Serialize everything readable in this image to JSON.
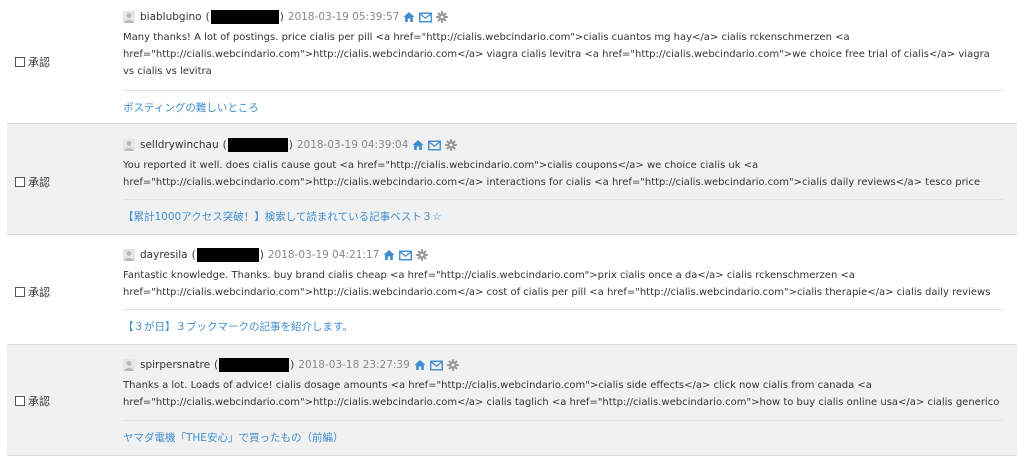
{
  "colors": {
    "link": "#3f8dd0",
    "icon_gray": "#999999",
    "row_alt_bg": "#f1f1f1"
  },
  "comments": [
    {
      "approve_label": "承認",
      "author": "biablubgino",
      "paren_open": "(",
      "paren_close": ")",
      "date": "2018-03-19 05:39:57",
      "body": "Many thanks! A lot of postings. price cialis per pill <a href=\"http://cialis.webcindario.com\">cialis cuantos mg hay</a> cialis rckenschmerzen <a href=\"http://cialis.webcindario.com\">http://cialis.webcindario.com</a> viagra cialis levitra <a href=\"http://cialis.webcindario.com\">we choice free trial of cialis</a> viagra vs cialis vs levitra",
      "post_title": "ポスティングの難しいところ",
      "icons": [
        "home-icon",
        "mail-icon",
        "gear-icon"
      ]
    },
    {
      "approve_label": "承認",
      "author": "selldrywinchau",
      "paren_open": "(",
      "paren_close": ")",
      "date": "2018-03-19 04:39:04",
      "body": "You reported it well. does cialis cause gout <a href=\"http://cialis.webcindario.com\">cialis coupons</a> we choice cialis uk <a href=\"http://cialis.webcindario.com\">http://cialis.webcindario.com</a> interactions for cialis <a href=\"http://cialis.webcindario.com\">cialis daily reviews</a> tesco price cialis",
      "post_title": "【累計1000アクセス突破！】検索して読まれている記事ベスト３☆",
      "icons": [
        "home-icon",
        "mail-icon",
        "gear-icon"
      ]
    },
    {
      "approve_label": "承認",
      "author": "dayresila",
      "paren_open": "(",
      "paren_close": ")",
      "date": "2018-03-19 04:21:17",
      "body": "Fantastic knowledge. Thanks. buy brand cialis cheap <a href=\"http://cialis.webcindario.com\">prix cialis once a da</a> cialis rckenschmerzen <a href=\"http://cialis.webcindario.com\">http://cialis.webcindario.com</a> cost of cialis per pill <a href=\"http://cialis.webcindario.com\">cialis therapie</a> cialis daily reviews",
      "post_title": "【３が日】３ブックマークの記事を紹介します。",
      "icons": [
        "home-icon",
        "mail-icon",
        "gear-icon"
      ]
    },
    {
      "approve_label": "承認",
      "author": "spirpersnatre",
      "paren_open": "(",
      "paren_close": ")",
      "date": "2018-03-18 23:27:39",
      "body": "Thanks a lot. Loads of advice! cialis dosage amounts <a href=\"http://cialis.webcindario.com\">cialis side effects</a> click now cialis from canada <a href=\"http://cialis.webcindario.com\">http://cialis.webcindario.com</a> cialis taglich <a href=\"http://cialis.webcindario.com\">how to buy cialis online usa</a> cialis generico lilly",
      "post_title": "ヤマダ電機「THE安心」で買ったもの（前編）",
      "icons": [
        "home-icon",
        "mail-icon",
        "gear-icon"
      ]
    }
  ]
}
